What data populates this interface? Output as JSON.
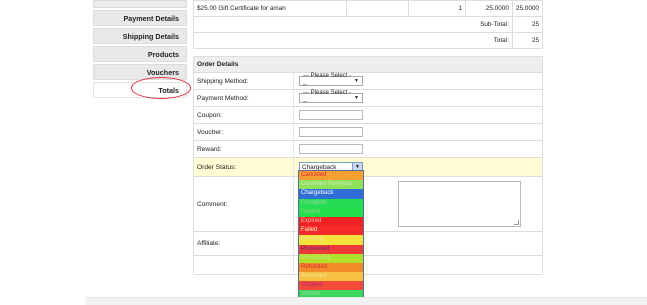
{
  "tabs": [
    {
      "label": ""
    },
    {
      "label": "Payment Details"
    },
    {
      "label": "Shipping Details"
    },
    {
      "label": "Products"
    },
    {
      "label": "Vouchers"
    },
    {
      "label": "Totals"
    }
  ],
  "products": {
    "item": {
      "name": "$25.00 Gift Certificate for aman",
      "model": "",
      "qty": "1",
      "price": "25.0000",
      "total": "25.0000"
    },
    "subtotal": {
      "label": "Sub-Total:",
      "value": "25"
    },
    "total": {
      "label": "Total:",
      "value": "25"
    }
  },
  "order_details": {
    "heading": "Order Details",
    "shipping_method": {
      "label": "Shipping Method:",
      "value": " --- Please Select --- "
    },
    "payment_method": {
      "label": "Payment Method:",
      "value": " --- Please Select --- "
    },
    "coupon": {
      "label": "Coupon:",
      "value": ""
    },
    "voucher": {
      "label": "Voucher:",
      "value": ""
    },
    "reward": {
      "label": "Reward:",
      "value": ""
    },
    "order_status": {
      "label": "Order Status:",
      "value": "Chargeback"
    },
    "comment": {
      "label": "Comment:",
      "value": ""
    },
    "affiliate": {
      "label": "Affiliate:",
      "value": ""
    }
  },
  "status_options": [
    {
      "label": "Canceled",
      "bg": "#f7a032",
      "fg": "#d8263a"
    },
    {
      "label": "Canceled Reversal",
      "bg": "#8ee35a",
      "fg": "#cfe8c0"
    },
    {
      "label": "Chargeback",
      "bg": "#2f6fd6",
      "fg": "#ffffff"
    },
    {
      "label": "Complete",
      "bg": "#25dd55",
      "fg": "#9ad8a0"
    },
    {
      "label": "Denied",
      "bg": "#22e04a",
      "fg": "#8fd18f"
    },
    {
      "label": "Expired",
      "bg": "#f22222",
      "fg": "#f7b7b7"
    },
    {
      "label": "Failed",
      "bg": "#f52a2a",
      "fg": "#fff6c0"
    },
    {
      "label": "Pending",
      "bg": "#f5e23a",
      "fg": "#f0e79c"
    },
    {
      "label": "Processed",
      "bg": "#f03a3a",
      "fg": "#5a2a6a"
    },
    {
      "label": "Processing",
      "bg": "#b0e02a",
      "fg": "#c6e88a"
    },
    {
      "label": "Refunded",
      "bg": "#f28a28",
      "fg": "#d8283a"
    },
    {
      "label": "Reversed",
      "bg": "#f7c242",
      "fg": "#f6e0a0"
    },
    {
      "label": "Shipped",
      "bg": "#f34a3a",
      "fg": "#b82a6a"
    },
    {
      "label": "Voided",
      "bg": "#38d860",
      "fg": "#9ad8a0"
    }
  ]
}
